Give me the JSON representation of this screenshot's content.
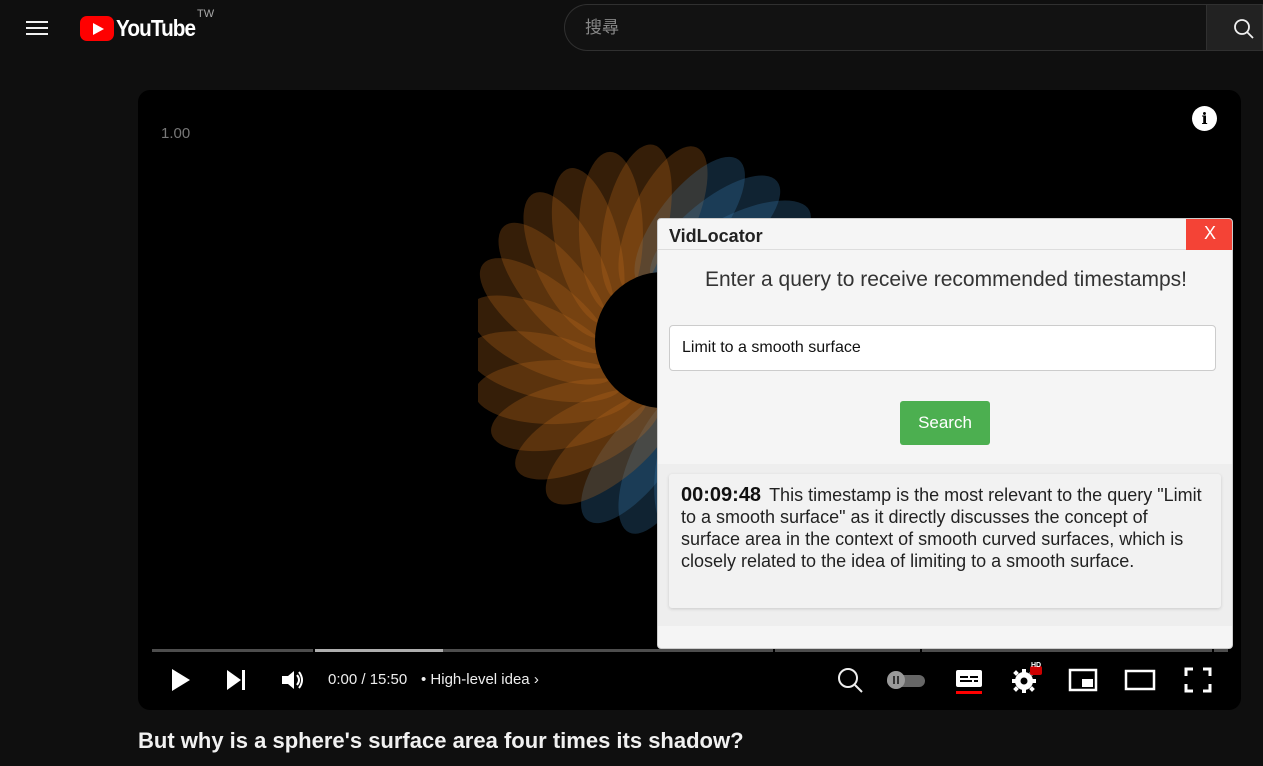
{
  "header": {
    "logo_text": "YouTube",
    "region": "TW",
    "search_placeholder": "搜尋"
  },
  "player": {
    "speed_label": "1.00",
    "info_label": "i",
    "time": "0:00 / 15:50",
    "chapter": "High-level idea",
    "progress_buffered_fraction": 0.27,
    "hd_badge": "HD"
  },
  "video": {
    "title": "But why is a sphere's surface area four times its shadow?"
  },
  "vidlocator": {
    "title": "VidLocator",
    "close_label": "X",
    "prompt": "Enter a query to receive recommended timestamps!",
    "query_value": "Limit to a smooth surface",
    "search_label": "Search",
    "results": [
      {
        "timestamp": "00:09:48",
        "text": "This timestamp is the most relevant to the query \"Limit to a smooth surface\" as it directly discusses the concept of surface area in the context of smooth curved surfaces, which is closely related to the idea of limiting to a smooth surface."
      }
    ]
  },
  "colors": {
    "brand_red": "#ff0000",
    "close_red": "#f44336",
    "search_green": "#4caf50"
  }
}
